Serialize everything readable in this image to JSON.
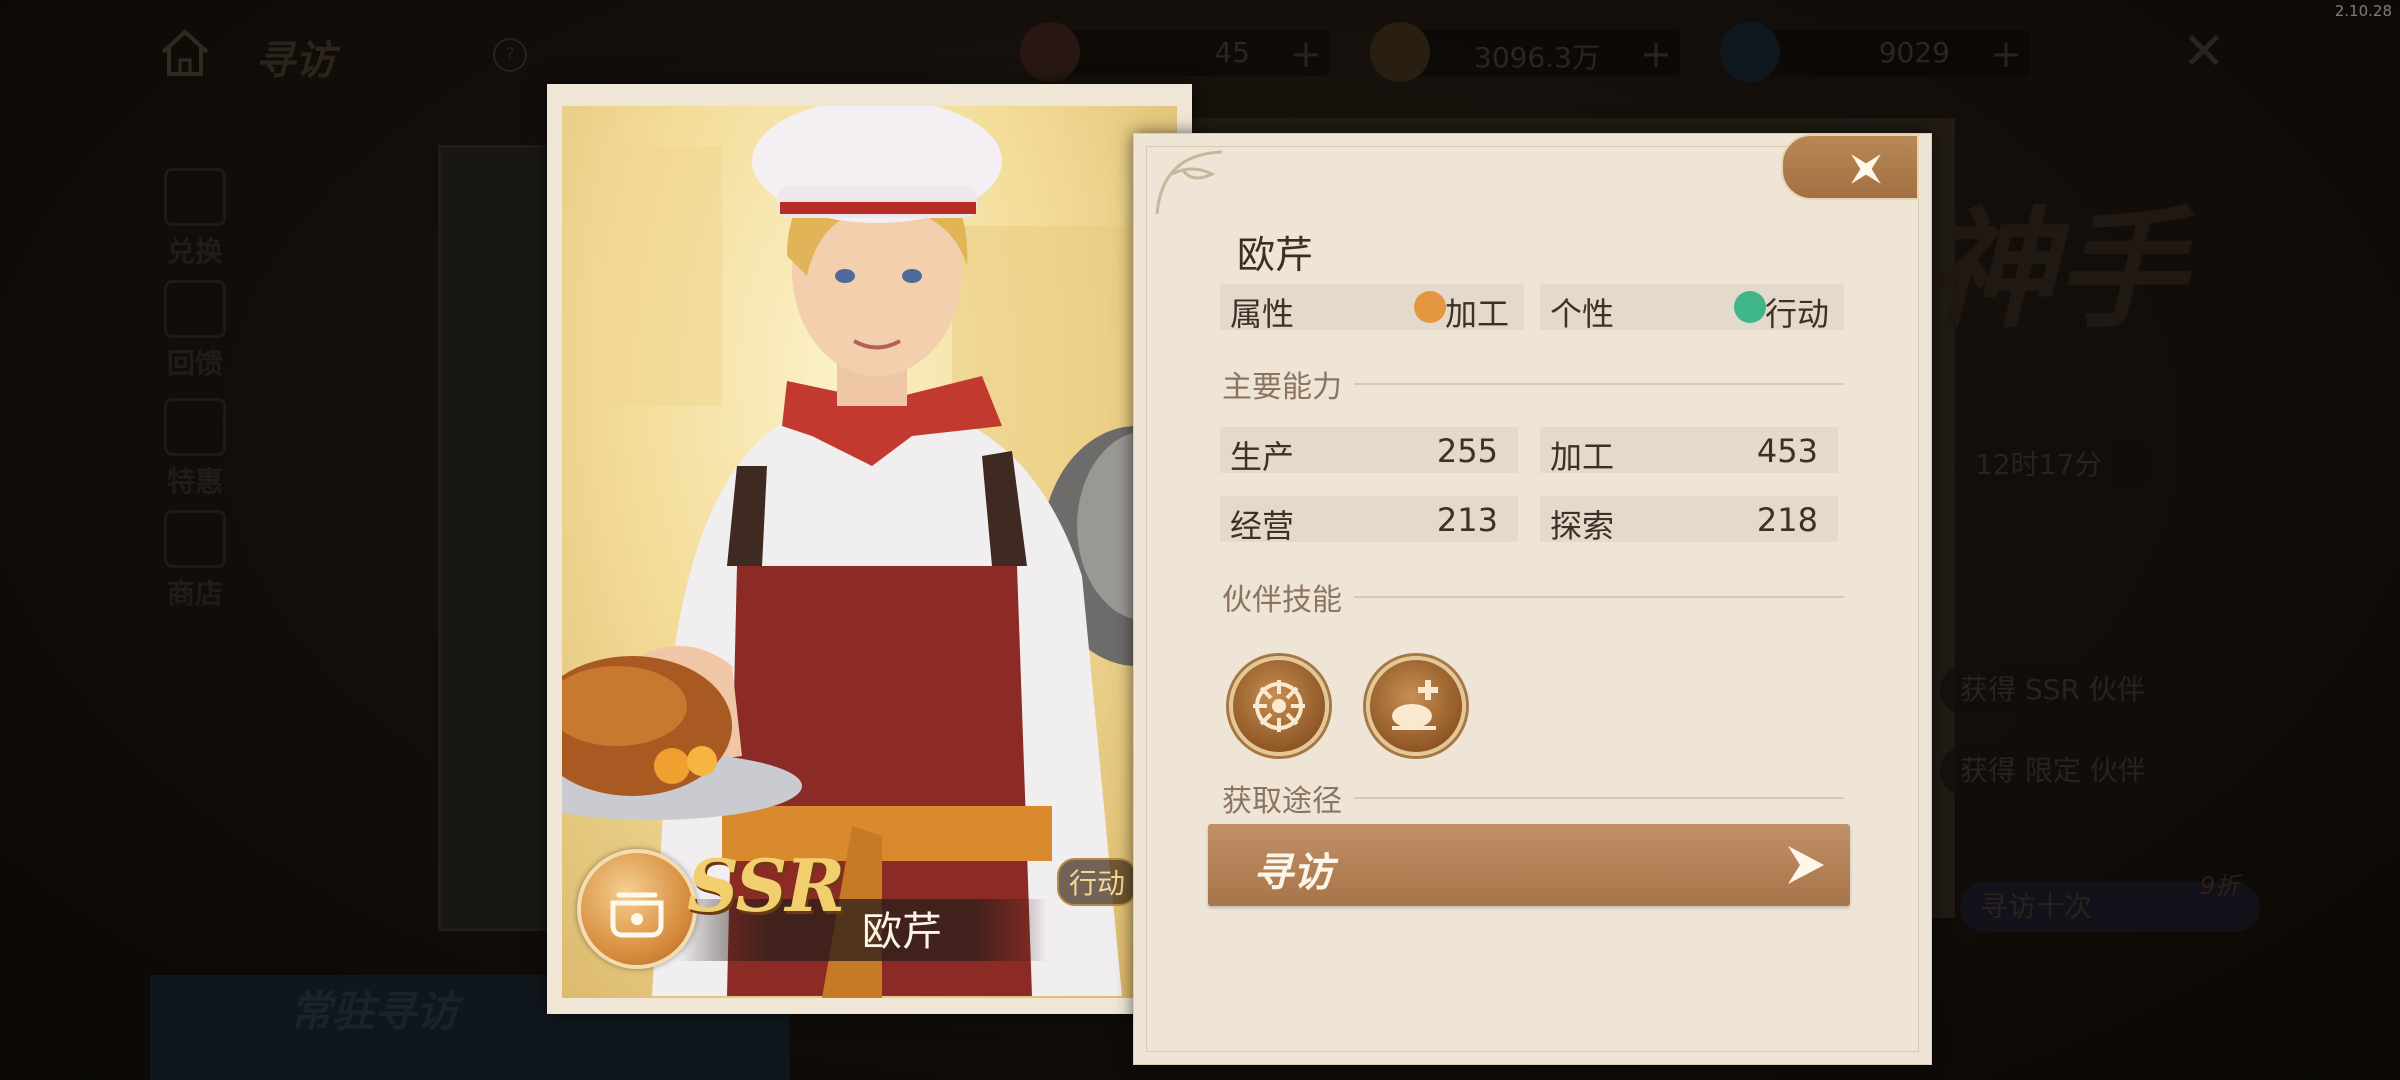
{
  "version": "2.10.28",
  "topbar": {
    "title": "寻访",
    "resources": [
      {
        "name": "ticket",
        "value": "45"
      },
      {
        "name": "coin",
        "value": "3096.3万"
      },
      {
        "name": "gem",
        "value": "9029"
      }
    ]
  },
  "sidebar": {
    "items": [
      {
        "label": "兑换"
      },
      {
        "label": "回馈"
      },
      {
        "label": "特惠"
      },
      {
        "label": "商店"
      }
    ]
  },
  "background": {
    "banner_text": "神手",
    "timer_text": "12时17分",
    "pill_ssr": "获得 SSR 伙伴",
    "pill_limited": "获得 限定 伙伴",
    "draw_ten": "寻访十次",
    "discount": "9折",
    "bottom_tab": "常驻寻访"
  },
  "card": {
    "rarity": "SSR",
    "name": "欧芹",
    "tag": "行动"
  },
  "panel": {
    "name": "欧芹",
    "attribute_label": "属性",
    "attribute_value": "加工",
    "personality_label": "个性",
    "personality_value": "行动",
    "abilities_title": "主要能力",
    "stats": [
      {
        "label": "生产",
        "value": "255"
      },
      {
        "label": "加工",
        "value": "453"
      },
      {
        "label": "经营",
        "value": "213"
      },
      {
        "label": "探索",
        "value": "218"
      }
    ],
    "skills_title": "伙伴技能",
    "skills": [
      {
        "icon": "crosshair-wheel-icon"
      },
      {
        "icon": "roast-chicken-plus-icon"
      }
    ],
    "acquire_title": "获取途径",
    "acquire_button": "寻访"
  },
  "colors": {
    "accent": "#a8744a",
    "panel_bg": "#eee5d6",
    "ssr_gold": "#f2cf6e",
    "personality_green": "#3fb58a"
  }
}
